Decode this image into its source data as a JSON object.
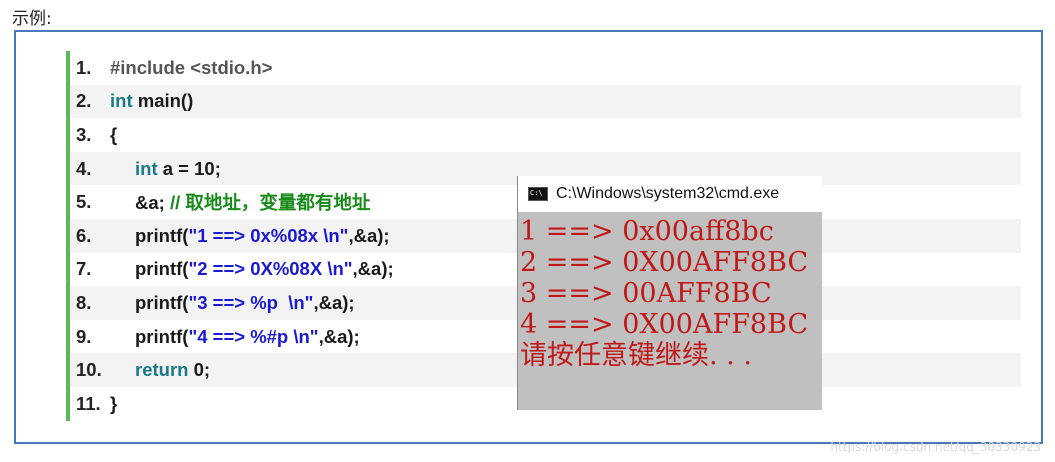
{
  "heading": "示例:",
  "code_lines": [
    {
      "num": "1.",
      "parts": [
        {
          "t": "#include <stdio.h>",
          "c": "pp"
        }
      ]
    },
    {
      "num": "2.",
      "parts": [
        {
          "t": "int",
          "c": "kw"
        },
        {
          "t": " main()",
          "c": ""
        }
      ]
    },
    {
      "num": "3.",
      "parts": [
        {
          "t": "{",
          "c": ""
        }
      ]
    },
    {
      "num": "4.",
      "indent": 1,
      "parts": [
        {
          "t": "int",
          "c": "kw"
        },
        {
          "t": " a = 10;",
          "c": ""
        }
      ]
    },
    {
      "num": "5.",
      "indent": 1,
      "parts": [
        {
          "t": "&a; ",
          "c": ""
        },
        {
          "t": "// 取地址，变量都有地址",
          "c": "cmt"
        }
      ]
    },
    {
      "num": "6.",
      "indent": 1,
      "parts": [
        {
          "t": "printf(",
          "c": ""
        },
        {
          "t": "\"1 ==> 0x%08x \\n\"",
          "c": "str"
        },
        {
          "t": ",&a);",
          "c": ""
        }
      ]
    },
    {
      "num": "7.",
      "indent": 1,
      "parts": [
        {
          "t": "printf(",
          "c": ""
        },
        {
          "t": "\"2 ==> 0X%08X \\n\"",
          "c": "str"
        },
        {
          "t": ",&a);",
          "c": ""
        }
      ]
    },
    {
      "num": "8.",
      "indent": 1,
      "parts": [
        {
          "t": "printf(",
          "c": ""
        },
        {
          "t": "\"3 ==> %p  \\n\"",
          "c": "str"
        },
        {
          "t": ",&a);",
          "c": ""
        }
      ]
    },
    {
      "num": "9.",
      "indent": 1,
      "parts": [
        {
          "t": "printf(",
          "c": ""
        },
        {
          "t": "\"4 ==> %#p \\n\"",
          "c": "str"
        },
        {
          "t": ",&a);",
          "c": ""
        }
      ]
    },
    {
      "num": "10.",
      "indent": 1,
      "parts": [
        {
          "t": "return",
          "c": "kw"
        },
        {
          "t": " 0;",
          "c": ""
        }
      ]
    },
    {
      "num": "11.",
      "parts": [
        {
          "t": "}",
          "c": ""
        }
      ]
    }
  ],
  "cmd": {
    "title": "C:\\Windows\\system32\\cmd.exe",
    "output": [
      "1 ==> 0x00aff8bc",
      "2 ==> 0X00AFF8BC",
      "3 ==> 00AFF8BC",
      "4 ==> 0X00AFF8BC",
      "请按任意键继续. . ."
    ]
  },
  "watermark": "https://blog.csdn.net/qq_30330923",
  "colors": {
    "frame": "#4a78b8",
    "gutter_bar": "#5cb85c",
    "keyword": "#1a7a8a",
    "string": "#1a1ad0",
    "comment": "#1a8a1a",
    "console_text": "#c01818",
    "console_bg": "#c0c0c0"
  }
}
